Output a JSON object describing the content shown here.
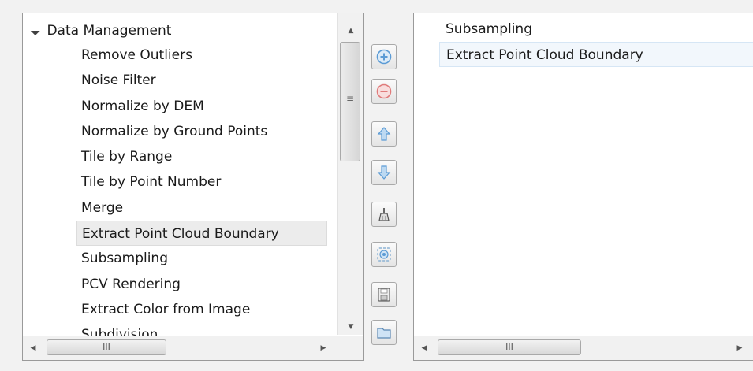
{
  "left_tree": {
    "root_label": "Data Management",
    "items": [
      {
        "label": "Remove Outliers",
        "selected": false
      },
      {
        "label": "Noise Filter",
        "selected": false
      },
      {
        "label": "Normalize by DEM",
        "selected": false
      },
      {
        "label": "Normalize by Ground Points",
        "selected": false
      },
      {
        "label": "Tile by Range",
        "selected": false
      },
      {
        "label": "Tile by Point Number",
        "selected": false
      },
      {
        "label": "Merge",
        "selected": false
      },
      {
        "label": "Extract Point Cloud Boundary",
        "selected": true
      },
      {
        "label": "Subsampling",
        "selected": false
      },
      {
        "label": "PCV Rendering",
        "selected": false
      },
      {
        "label": "Extract Color from Image",
        "selected": false
      },
      {
        "label": "Subdivision",
        "selected": false
      }
    ],
    "scroll_grip": "≡",
    "hscroll_grip": "III"
  },
  "right_list": {
    "items": [
      {
        "label": "Subsampling",
        "selected": false
      },
      {
        "label": "Extract Point Cloud Boundary",
        "selected": true
      }
    ],
    "hscroll_grip": "III"
  },
  "toolbar": {
    "buttons": [
      {
        "name": "add-button",
        "icon": "plus-circle-icon"
      },
      {
        "name": "remove-button",
        "icon": "minus-circle-icon"
      },
      {
        "name": "move-up-button",
        "icon": "arrow-up-icon"
      },
      {
        "name": "move-down-button",
        "icon": "arrow-down-icon"
      },
      {
        "name": "clear-button",
        "icon": "brush-icon"
      },
      {
        "name": "settings-button",
        "icon": "target-icon"
      },
      {
        "name": "save-button",
        "icon": "save-icon"
      },
      {
        "name": "open-button",
        "icon": "folder-icon"
      }
    ]
  },
  "colors": {
    "icon_blue": "#5b9bd5",
    "icon_red": "#e07b7b",
    "selection_left": "#ececec",
    "selection_right": "#f2f7fc"
  }
}
